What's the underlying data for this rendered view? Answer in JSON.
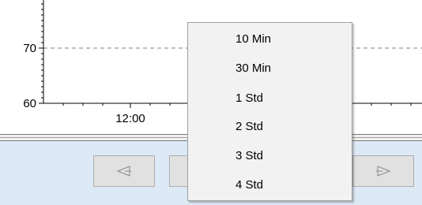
{
  "chart": {
    "y_ticks": [
      {
        "label": "70",
        "value": 70
      },
      {
        "label": "60",
        "value": 60
      }
    ],
    "x_ticks": [
      {
        "label": "12:00"
      }
    ],
    "gridline_color": "#808080"
  },
  "toolbar": {
    "background": "#dde9f5",
    "prev_icon": "triangle-left-icon",
    "next_icon": "triangle-right-icon"
  },
  "menu": {
    "items": [
      "10 Min",
      "30 Min",
      "1 Std",
      "2 Std",
      "3 Std",
      "4 Std"
    ]
  }
}
